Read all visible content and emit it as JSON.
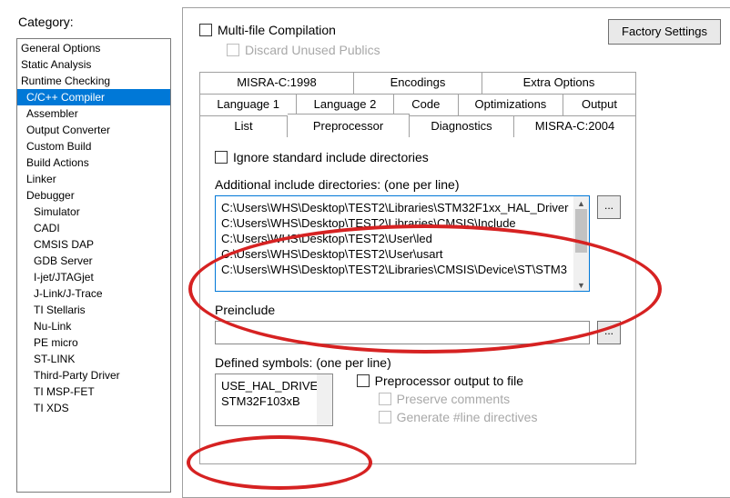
{
  "labels": {
    "category": "Category:",
    "factory": "Factory Settings",
    "multiFile": "Multi-file Compilation",
    "discard": "Discard Unused Publics",
    "ignoreStd": "Ignore standard include directories",
    "addlInclude": "Additional include directories: (one per line)",
    "preinclude": "Preinclude",
    "definedSymbols": "Defined symbols: (one per line)",
    "preprocOut": "Preprocessor output to file",
    "preserveComments": "Preserve comments",
    "genLine": "Generate #line directives",
    "browse": "..."
  },
  "categories": [
    {
      "label": "General Options",
      "indent": false,
      "selected": false
    },
    {
      "label": "Static Analysis",
      "indent": false,
      "selected": false
    },
    {
      "label": "Runtime Checking",
      "indent": false,
      "selected": false
    },
    {
      "label": "C/C++ Compiler",
      "indent": true,
      "selected": true
    },
    {
      "label": "Assembler",
      "indent": true,
      "selected": false
    },
    {
      "label": "Output Converter",
      "indent": true,
      "selected": false
    },
    {
      "label": "Custom Build",
      "indent": true,
      "selected": false
    },
    {
      "label": "Build Actions",
      "indent": true,
      "selected": false
    },
    {
      "label": "Linker",
      "indent": true,
      "selected": false
    },
    {
      "label": "Debugger",
      "indent": true,
      "selected": false
    },
    {
      "label": "Simulator",
      "indent": true,
      "selected": false,
      "double": true
    },
    {
      "label": "CADI",
      "indent": true,
      "selected": false,
      "double": true
    },
    {
      "label": "CMSIS DAP",
      "indent": true,
      "selected": false,
      "double": true
    },
    {
      "label": "GDB Server",
      "indent": true,
      "selected": false,
      "double": true
    },
    {
      "label": "I-jet/JTAGjet",
      "indent": true,
      "selected": false,
      "double": true
    },
    {
      "label": "J-Link/J-Trace",
      "indent": true,
      "selected": false,
      "double": true
    },
    {
      "label": "TI Stellaris",
      "indent": true,
      "selected": false,
      "double": true
    },
    {
      "label": "Nu-Link",
      "indent": true,
      "selected": false,
      "double": true
    },
    {
      "label": "PE micro",
      "indent": true,
      "selected": false,
      "double": true
    },
    {
      "label": "ST-LINK",
      "indent": true,
      "selected": false,
      "double": true
    },
    {
      "label": "Third-Party Driver",
      "indent": true,
      "selected": false,
      "double": true
    },
    {
      "label": "TI MSP-FET",
      "indent": true,
      "selected": false,
      "double": true
    },
    {
      "label": "TI XDS",
      "indent": true,
      "selected": false,
      "double": true
    }
  ],
  "tabs": {
    "row1": [
      "MISRA-C:1998",
      "Encodings",
      "Extra Options"
    ],
    "row2": [
      "Language 1",
      "Language 2",
      "Code",
      "Optimizations",
      "Output"
    ],
    "row3": [
      "List",
      "Preprocessor",
      "Diagnostics",
      "MISRA-C:2004"
    ],
    "active": "Preprocessor"
  },
  "includeDirs": [
    "C:\\Users\\WHS\\Desktop\\TEST2\\Libraries\\STM32F1xx_HAL_Driver",
    "C:\\Users\\WHS\\Desktop\\TEST2\\Libraries\\CMSIS\\Include",
    "C:\\Users\\WHS\\Desktop\\TEST2\\User\\led",
    "C:\\Users\\WHS\\Desktop\\TEST2\\User\\usart",
    "C:\\Users\\WHS\\Desktop\\TEST2\\Libraries\\CMSIS\\Device\\ST\\STM3"
  ],
  "definedSymbols": [
    "USE_HAL_DRIVER",
    "STM32F103xB"
  ]
}
